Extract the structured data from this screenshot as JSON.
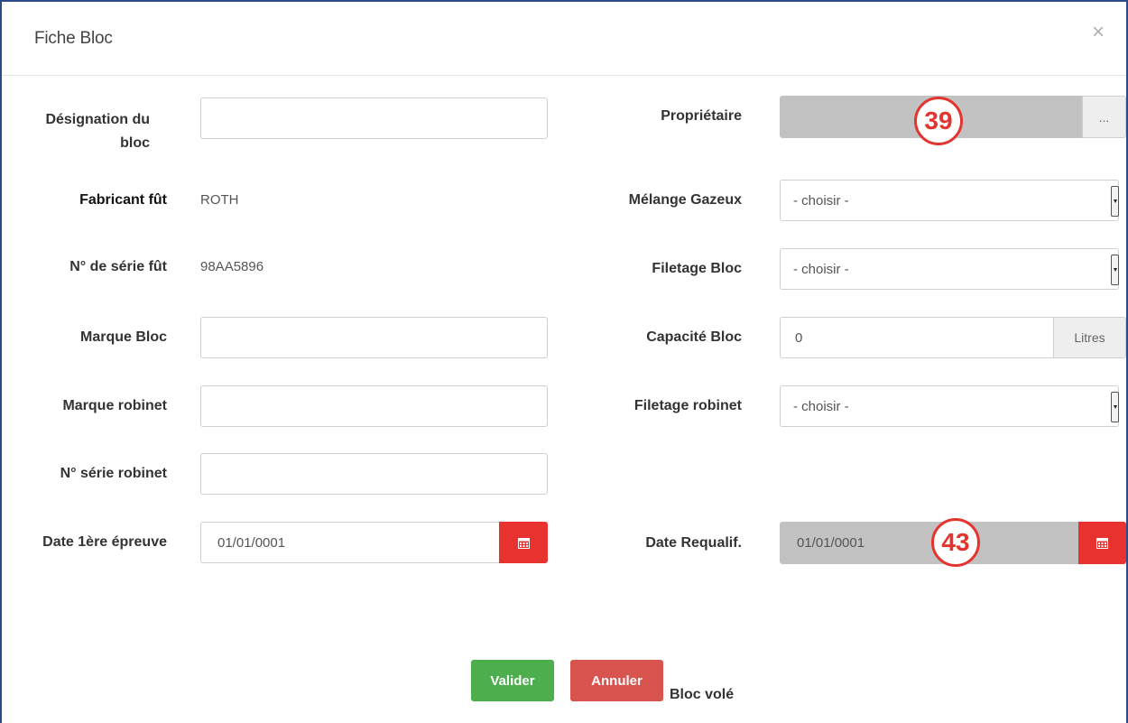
{
  "modal": {
    "title": "Fiche Bloc",
    "close_icon": "×"
  },
  "left": {
    "designation_label_1": "Désignation du",
    "designation_label_2": "bloc",
    "designation_value": "",
    "fabricant_label": "Fabricant fût",
    "fabricant_value": "ROTH",
    "serie_fut_label": "N° de série fût",
    "serie_fut_value": "98AA5896",
    "marque_bloc_label": "Marque Bloc",
    "marque_bloc_value": "",
    "marque_robinet_label": "Marque robinet",
    "marque_robinet_value": "",
    "serie_robinet_label": "N° série robinet",
    "serie_robinet_value": "",
    "date_epreuve_label": "Date 1ère épreuve",
    "date_epreuve_value": "01/01/0001"
  },
  "right": {
    "proprietaire_label": "Propriétaire",
    "proprietaire_button": "...",
    "melange_label": "Mélange Gazeux",
    "melange_value": "- choisir -",
    "filetage_bloc_label": "Filetage Bloc",
    "filetage_bloc_value": "- choisir -",
    "capacite_label": "Capacité Bloc",
    "capacite_value": "0",
    "capacite_unit": "Litres",
    "filetage_robinet_label": "Filetage robinet",
    "filetage_robinet_value": "- choisir -",
    "date_requalif_label": "Date Requalif.",
    "date_requalif_value": "01/01/0001"
  },
  "callouts": {
    "proprietaire": "39",
    "date_requalif": "43"
  },
  "bloc_vole_label": "Bloc volé",
  "buttons": {
    "valider": "Valider",
    "annuler": "Annuler"
  },
  "icons": {
    "calendar": "calendar-icon",
    "dropdown": "chevron-down-icon",
    "close": "close-icon"
  },
  "colors": {
    "danger": "#e8322f",
    "success": "#4cae4c",
    "cancel": "#d9534f",
    "frame": "#2d4a8a",
    "readonly_bg": "#c2c2c2"
  }
}
